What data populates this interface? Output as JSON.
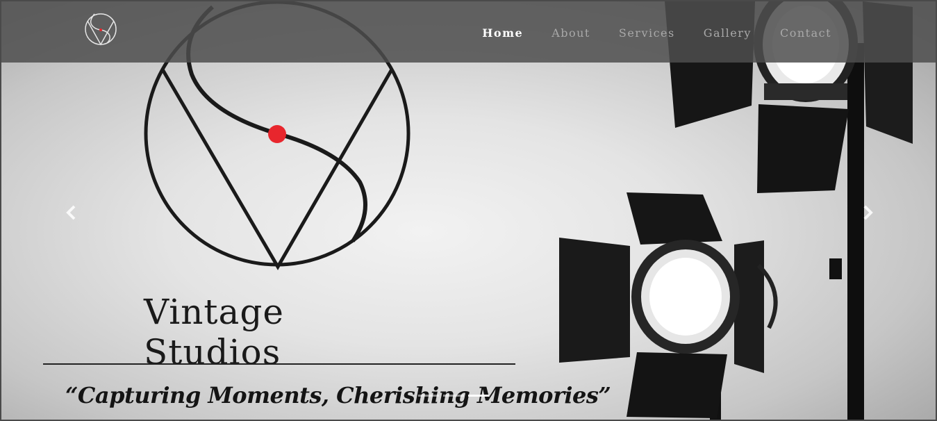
{
  "navbar": {
    "logo_name": "Vintage Studios",
    "links": [
      {
        "label": "Home",
        "active": true
      },
      {
        "label": "About",
        "active": false
      },
      {
        "label": "Services",
        "active": false
      },
      {
        "label": "Gallery",
        "active": false
      },
      {
        "label": "Contact",
        "active": false
      }
    ]
  },
  "hero": {
    "brand_name": "Vintage Studios",
    "tagline": "“Capturing Moments, Cherishing Memories”",
    "accent_color": "#e8262d"
  },
  "carousel": {
    "prev_icon": "chevron-left-icon",
    "next_icon": "chevron-right-icon",
    "slide_count": 3,
    "active_slide": 2
  }
}
